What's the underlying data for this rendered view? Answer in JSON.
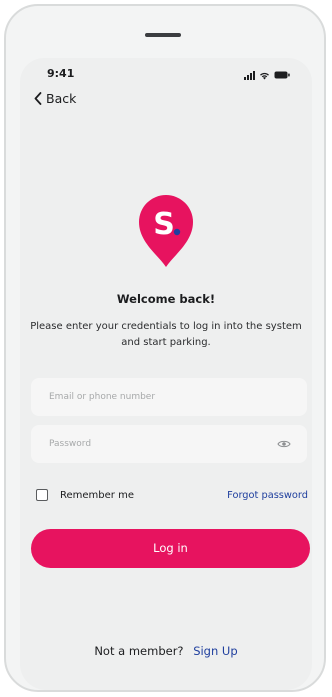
{
  "status_bar": {
    "time": "9:41"
  },
  "nav": {
    "back_label": "Back"
  },
  "brand": {
    "logo_letter": "S",
    "color": "#e7135f"
  },
  "header": {
    "title": "Welcome back!",
    "subtitle": "Please enter your credentials to log in into the system and start parking."
  },
  "form": {
    "email_placeholder": "Email or phone number",
    "email_value": "",
    "password_placeholder": "Password",
    "password_value": "",
    "remember_label": "Remember me",
    "remember_checked": false,
    "forgot_label": "Forgot password",
    "login_label": "Log in"
  },
  "footer": {
    "prompt": "Not a member?",
    "signup_label": "Sign Up"
  },
  "colors": {
    "accent": "#e7135f",
    "link": "#1f3f9e"
  }
}
